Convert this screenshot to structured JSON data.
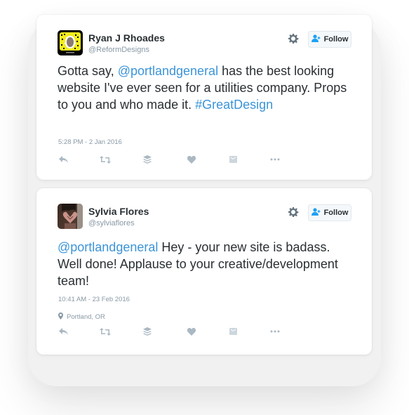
{
  "colors": {
    "link": "#3b94d9",
    "text": "#292f33",
    "muted": "#8899a6",
    "icon": "#aab8c2",
    "follow_icon": "#1da1f2"
  },
  "tweets": [
    {
      "author": {
        "name": "Ryan J Rhoades",
        "handle": "@ReformDesigns",
        "avatar": "snapcode-avatar"
      },
      "follow_label": "Follow",
      "text": {
        "part1": "Gotta say, ",
        "mention": "@portlandgeneral",
        "part2": " has the best looking website I've ever seen for a utilities company. Props to you and who made it. ",
        "hashtag": "#GreatDesign"
      },
      "timestamp": "5:28 PM - 2 Jan 2016",
      "location": null,
      "actions": [
        "reply-icon",
        "retweet-icon",
        "buffer-icon",
        "like-icon",
        "media-icon",
        "more-icon"
      ]
    },
    {
      "author": {
        "name": "Sylvia Flores",
        "handle": "@sylviaflores",
        "avatar": "photo-avatar"
      },
      "follow_label": "Follow",
      "text": {
        "mention": "@portlandgeneral",
        "part2": " Hey - your new site is badass. Well done! Applause to your creative/development team!"
      },
      "timestamp": "10:41 AM - 23 Feb 2016",
      "location": "Portland, OR",
      "actions": [
        "reply-icon",
        "retweet-icon",
        "buffer-icon",
        "like-icon",
        "media-icon",
        "more-icon"
      ]
    }
  ]
}
